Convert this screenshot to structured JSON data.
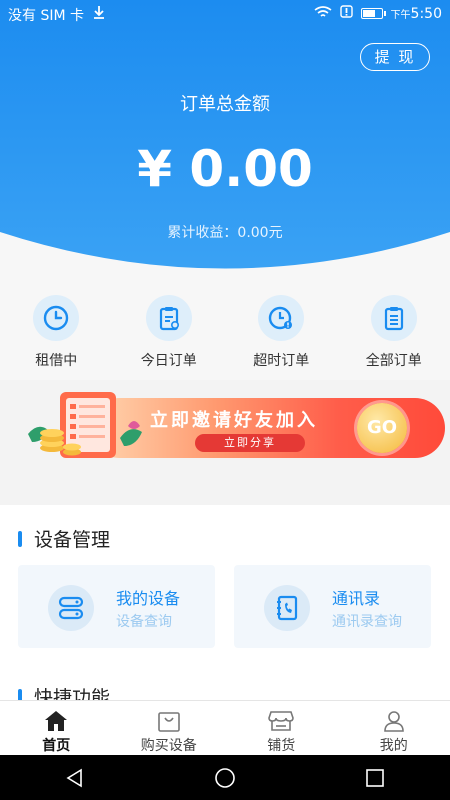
{
  "status_bar": {
    "carrier": "没有 SIM 卡",
    "time_prefix": "下午",
    "time": "5:50"
  },
  "header": {
    "withdraw_label": "提 现",
    "total_label": "订单总金额",
    "total_amount": "¥ 0.00",
    "earnings": "累计收益：0.00元"
  },
  "quick_actions": [
    {
      "label": "租借中",
      "icon": "clock-icon"
    },
    {
      "label": "今日订单",
      "icon": "clipboard-icon"
    },
    {
      "label": "超时订单",
      "icon": "overtime-clock-icon"
    },
    {
      "label": "全部订单",
      "icon": "list-clipboard-icon"
    }
  ],
  "banner": {
    "title": "立即邀请好友加入",
    "button_label": "立即分享",
    "go_label": "GO"
  },
  "device_section": {
    "title": "设备管理",
    "cards": [
      {
        "title": "我的设备",
        "subtitle": "设备查询",
        "icon": "device-icon"
      },
      {
        "title": "通讯录",
        "subtitle": "通讯录查询",
        "icon": "contacts-icon"
      }
    ]
  },
  "shortcut_section": {
    "title": "快捷功能"
  },
  "tabs": [
    {
      "label": "首页",
      "icon": "home-icon",
      "active": true
    },
    {
      "label": "购买设备",
      "icon": "shopping-bag-icon",
      "active": false
    },
    {
      "label": "铺货",
      "icon": "store-icon",
      "active": false
    },
    {
      "label": "我的",
      "icon": "user-icon",
      "active": false
    }
  ],
  "colors": {
    "primary": "#1a8cf0",
    "hero_top": "#1e8ff0",
    "banner_end": "#ff4a3a"
  }
}
